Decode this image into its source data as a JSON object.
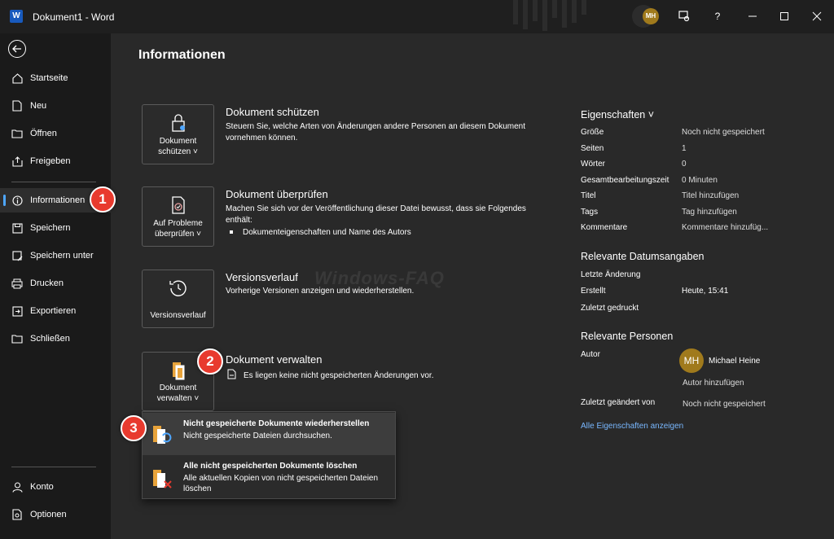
{
  "titlebar": {
    "app_icon": "word-logo",
    "title": "Dokument1  -  Word",
    "avatar_initials": "MH"
  },
  "sidebar": {
    "items": [
      {
        "label": "Startseite",
        "icon": "home-icon"
      },
      {
        "label": "Neu",
        "icon": "new-doc-icon"
      },
      {
        "label": "Öffnen",
        "icon": "folder-icon"
      },
      {
        "label": "Freigeben",
        "icon": "share-icon"
      },
      {
        "label": "Informationen",
        "icon": "info-icon",
        "active": true
      },
      {
        "label": "Speichern",
        "icon": "save-icon"
      },
      {
        "label": "Speichern unter",
        "icon": "save-as-icon"
      },
      {
        "label": "Drucken",
        "icon": "print-icon"
      },
      {
        "label": "Exportieren",
        "icon": "export-icon"
      },
      {
        "label": "Schließen",
        "icon": "close-doc-icon"
      }
    ],
    "bottom": [
      {
        "label": "Konto",
        "icon": "account-icon"
      },
      {
        "label": "Optionen",
        "icon": "options-icon"
      }
    ]
  },
  "main": {
    "title": "Informationen",
    "sections": {
      "protect": {
        "button": [
          "Dokument",
          "schützen ˅"
        ],
        "title": "Dokument schützen",
        "desc": "Steuern Sie, welche Arten von Änderungen andere Personen an diesem Dokument vornehmen können."
      },
      "inspect": {
        "button": [
          "Auf Probleme",
          "überprüfen ˅"
        ],
        "title": "Dokument überprüfen",
        "desc": "Machen Sie sich vor der Veröffentlichung dieser Datei bewusst, dass sie Folgendes enthält:",
        "bullet": "Dokumenteigenschaften und Name des Autors"
      },
      "versions": {
        "button": [
          "Versionsverlauf"
        ],
        "title": "Versionsverlauf",
        "desc": "Vorherige Versionen anzeigen und wiederherstellen."
      },
      "manage": {
        "button": [
          "Dokument",
          "verwalten ˅"
        ],
        "title": "Dokument verwalten",
        "desc": "Es liegen keine nicht gespeicherten Änderungen vor."
      }
    },
    "dropdown": [
      {
        "title": "Nicht gespeicherte Dokumente wiederherstellen",
        "desc": "Nicht gespeicherte Dateien durchsuchen."
      },
      {
        "title": "Alle nicht gespeicherten Dokumente löschen",
        "desc": "Alle aktuellen Kopien von nicht gespeicherten Dateien löschen"
      }
    ],
    "watermark": "Windows-FAQ"
  },
  "properties": {
    "head": "Eigenschaften ˅",
    "rows": [
      {
        "label": "Größe",
        "value": "Noch nicht gespeichert"
      },
      {
        "label": "Seiten",
        "value": "1"
      },
      {
        "label": "Wörter",
        "value": "0"
      },
      {
        "label": "Gesamtbearbeitungszeit",
        "value": "0 Minuten"
      },
      {
        "label": "Titel",
        "value": "Titel hinzufügen"
      },
      {
        "label": "Tags",
        "value": "Tag hinzufügen"
      },
      {
        "label": "Kommentare",
        "value": "Kommentare hinzufüg..."
      }
    ],
    "dates_head": "Relevante Datumsangaben",
    "dates": [
      {
        "label": "Letzte Änderung",
        "value": ""
      },
      {
        "label": "Erstellt",
        "value": "Heute, 15:41"
      },
      {
        "label": "Zuletzt gedruckt",
        "value": ""
      }
    ],
    "people_head": "Relevante Personen",
    "author_label": "Autor",
    "author_initials": "MH",
    "author_name": "Michael Heine",
    "add_author": "Autor hinzufügen",
    "last_modified_by_label": "Zuletzt geändert von",
    "last_modified_by_value": "Noch nicht gespeichert",
    "show_all": "Alle Eigenschaften anzeigen"
  },
  "badges": [
    "1",
    "2",
    "3"
  ],
  "colors": {
    "accent": "#4ea6ff",
    "badge": "#e83a2e",
    "avatar": "#a07a1c",
    "link": "#79b8ff"
  }
}
